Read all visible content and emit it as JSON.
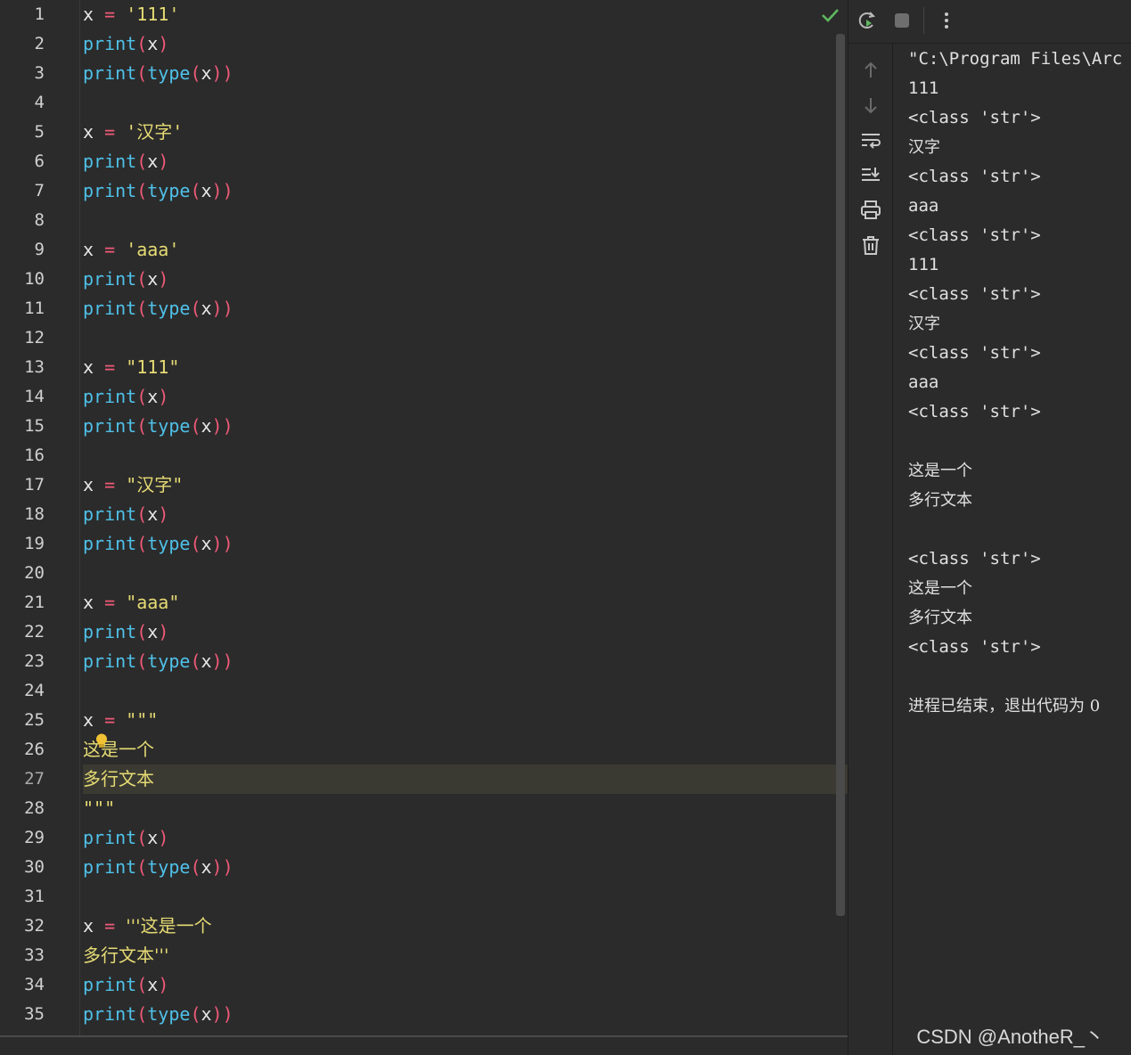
{
  "editor": {
    "current_line": 27,
    "lines": [
      {
        "n": "1",
        "tokens": [
          {
            "t": "x ",
            "c": "var"
          },
          {
            "t": "= ",
            "c": "op"
          },
          {
            "t": "'111'",
            "c": "str"
          }
        ]
      },
      {
        "n": "2",
        "tokens": [
          {
            "t": "print",
            "c": "fn"
          },
          {
            "t": "(",
            "c": "paren"
          },
          {
            "t": "x",
            "c": "var"
          },
          {
            "t": ")",
            "c": "paren"
          }
        ]
      },
      {
        "n": "3",
        "tokens": [
          {
            "t": "print",
            "c": "fn"
          },
          {
            "t": "(",
            "c": "paren"
          },
          {
            "t": "type",
            "c": "fn"
          },
          {
            "t": "(",
            "c": "paren"
          },
          {
            "t": "x",
            "c": "var"
          },
          {
            "t": "))",
            "c": "paren"
          }
        ]
      },
      {
        "n": "4",
        "tokens": []
      },
      {
        "n": "5",
        "tokens": [
          {
            "t": "x ",
            "c": "var"
          },
          {
            "t": "= ",
            "c": "op"
          },
          {
            "t": "'汉字'",
            "c": "str"
          }
        ]
      },
      {
        "n": "6",
        "tokens": [
          {
            "t": "print",
            "c": "fn"
          },
          {
            "t": "(",
            "c": "paren"
          },
          {
            "t": "x",
            "c": "var"
          },
          {
            "t": ")",
            "c": "paren"
          }
        ]
      },
      {
        "n": "7",
        "tokens": [
          {
            "t": "print",
            "c": "fn"
          },
          {
            "t": "(",
            "c": "paren"
          },
          {
            "t": "type",
            "c": "fn"
          },
          {
            "t": "(",
            "c": "paren"
          },
          {
            "t": "x",
            "c": "var"
          },
          {
            "t": "))",
            "c": "paren"
          }
        ]
      },
      {
        "n": "8",
        "tokens": []
      },
      {
        "n": "9",
        "tokens": [
          {
            "t": "x ",
            "c": "var"
          },
          {
            "t": "= ",
            "c": "op"
          },
          {
            "t": "'aaa'",
            "c": "str"
          }
        ]
      },
      {
        "n": "10",
        "tokens": [
          {
            "t": "print",
            "c": "fn"
          },
          {
            "t": "(",
            "c": "paren"
          },
          {
            "t": "x",
            "c": "var"
          },
          {
            "t": ")",
            "c": "paren"
          }
        ]
      },
      {
        "n": "11",
        "tokens": [
          {
            "t": "print",
            "c": "fn"
          },
          {
            "t": "(",
            "c": "paren"
          },
          {
            "t": "type",
            "c": "fn"
          },
          {
            "t": "(",
            "c": "paren"
          },
          {
            "t": "x",
            "c": "var"
          },
          {
            "t": "))",
            "c": "paren"
          }
        ]
      },
      {
        "n": "12",
        "tokens": []
      },
      {
        "n": "13",
        "tokens": [
          {
            "t": "x ",
            "c": "var"
          },
          {
            "t": "= ",
            "c": "op"
          },
          {
            "t": "\"111\"",
            "c": "str"
          }
        ]
      },
      {
        "n": "14",
        "tokens": [
          {
            "t": "print",
            "c": "fn"
          },
          {
            "t": "(",
            "c": "paren"
          },
          {
            "t": "x",
            "c": "var"
          },
          {
            "t": ")",
            "c": "paren"
          }
        ]
      },
      {
        "n": "15",
        "tokens": [
          {
            "t": "print",
            "c": "fn"
          },
          {
            "t": "(",
            "c": "paren"
          },
          {
            "t": "type",
            "c": "fn"
          },
          {
            "t": "(",
            "c": "paren"
          },
          {
            "t": "x",
            "c": "var"
          },
          {
            "t": "))",
            "c": "paren"
          }
        ]
      },
      {
        "n": "16",
        "tokens": []
      },
      {
        "n": "17",
        "tokens": [
          {
            "t": "x ",
            "c": "var"
          },
          {
            "t": "= ",
            "c": "op"
          },
          {
            "t": "\"汉字\"",
            "c": "str"
          }
        ]
      },
      {
        "n": "18",
        "tokens": [
          {
            "t": "print",
            "c": "fn"
          },
          {
            "t": "(",
            "c": "paren"
          },
          {
            "t": "x",
            "c": "var"
          },
          {
            "t": ")",
            "c": "paren"
          }
        ]
      },
      {
        "n": "19",
        "tokens": [
          {
            "t": "print",
            "c": "fn"
          },
          {
            "t": "(",
            "c": "paren"
          },
          {
            "t": "type",
            "c": "fn"
          },
          {
            "t": "(",
            "c": "paren"
          },
          {
            "t": "x",
            "c": "var"
          },
          {
            "t": "))",
            "c": "paren"
          }
        ]
      },
      {
        "n": "20",
        "tokens": []
      },
      {
        "n": "21",
        "tokens": [
          {
            "t": "x ",
            "c": "var"
          },
          {
            "t": "= ",
            "c": "op"
          },
          {
            "t": "\"aaa\"",
            "c": "str"
          }
        ]
      },
      {
        "n": "22",
        "tokens": [
          {
            "t": "print",
            "c": "fn"
          },
          {
            "t": "(",
            "c": "paren"
          },
          {
            "t": "x",
            "c": "var"
          },
          {
            "t": ")",
            "c": "paren"
          }
        ]
      },
      {
        "n": "23",
        "tokens": [
          {
            "t": "print",
            "c": "fn"
          },
          {
            "t": "(",
            "c": "paren"
          },
          {
            "t": "type",
            "c": "fn"
          },
          {
            "t": "(",
            "c": "paren"
          },
          {
            "t": "x",
            "c": "var"
          },
          {
            "t": "))",
            "c": "paren"
          }
        ]
      },
      {
        "n": "24",
        "tokens": []
      },
      {
        "n": "25",
        "tokens": [
          {
            "t": "x ",
            "c": "var"
          },
          {
            "t": "= ",
            "c": "op"
          },
          {
            "t": "\"\"\"",
            "c": "str"
          }
        ]
      },
      {
        "n": "26",
        "tokens": [
          {
            "t": "这是一个",
            "c": "str cn"
          }
        ]
      },
      {
        "n": "27",
        "tokens": [
          {
            "t": "多行文本",
            "c": "str cn"
          }
        ]
      },
      {
        "n": "28",
        "tokens": [
          {
            "t": "\"\"\"",
            "c": "str"
          }
        ]
      },
      {
        "n": "29",
        "tokens": [
          {
            "t": "print",
            "c": "fn"
          },
          {
            "t": "(",
            "c": "paren"
          },
          {
            "t": "x",
            "c": "var"
          },
          {
            "t": ")",
            "c": "paren"
          }
        ]
      },
      {
        "n": "30",
        "tokens": [
          {
            "t": "print",
            "c": "fn"
          },
          {
            "t": "(",
            "c": "paren"
          },
          {
            "t": "type",
            "c": "fn"
          },
          {
            "t": "(",
            "c": "paren"
          },
          {
            "t": "x",
            "c": "var"
          },
          {
            "t": "))",
            "c": "paren"
          }
        ]
      },
      {
        "n": "31",
        "tokens": []
      },
      {
        "n": "32",
        "tokens": [
          {
            "t": "x ",
            "c": "var"
          },
          {
            "t": "= ",
            "c": "op"
          },
          {
            "t": "'''这是一个",
            "c": "str cn"
          }
        ]
      },
      {
        "n": "33",
        "tokens": [
          {
            "t": "多行文本'''",
            "c": "str cn"
          }
        ]
      },
      {
        "n": "34",
        "tokens": [
          {
            "t": "print",
            "c": "fn"
          },
          {
            "t": "(",
            "c": "paren"
          },
          {
            "t": "x",
            "c": "var"
          },
          {
            "t": ")",
            "c": "paren"
          }
        ]
      },
      {
        "n": "35",
        "tokens": [
          {
            "t": "print",
            "c": "fn"
          },
          {
            "t": "(",
            "c": "paren"
          },
          {
            "t": "type",
            "c": "fn"
          },
          {
            "t": "(",
            "c": "paren"
          },
          {
            "t": "x",
            "c": "var"
          },
          {
            "t": "))",
            "c": "paren"
          }
        ]
      }
    ]
  },
  "run_panel": {
    "toolbar": [
      {
        "name": "rerun-icon"
      },
      {
        "name": "stop-icon"
      },
      {
        "name": "more-options-icon"
      }
    ],
    "side_tools": [
      {
        "name": "scroll-up-icon"
      },
      {
        "name": "scroll-down-icon"
      },
      {
        "name": "soft-wrap-icon"
      },
      {
        "name": "scroll-to-end-icon"
      },
      {
        "name": "print-icon"
      },
      {
        "name": "clear-all-icon"
      }
    ],
    "console_lines": [
      "\"C:\\Program Files\\Arc",
      "111",
      "<class 'str'>",
      "汉字",
      "<class 'str'>",
      "aaa",
      "<class 'str'>",
      "111",
      "<class 'str'>",
      "汉字",
      "<class 'str'>",
      "aaa",
      "<class 'str'>",
      "",
      "这是一个",
      "多行文本",
      "",
      "<class 'str'>",
      "这是一个",
      "多行文本",
      "<class 'str'>",
      "",
      "进程已结束，退出代码为 0"
    ]
  },
  "watermark": "CSDN @AnotheR_丶",
  "colors": {
    "background": "#2b2b2b",
    "keyword_function": "#4fc1e9",
    "operator": "#f05a78",
    "string": "#e6db74",
    "current_line": "#3b3a32",
    "check": "#5fb85f"
  }
}
